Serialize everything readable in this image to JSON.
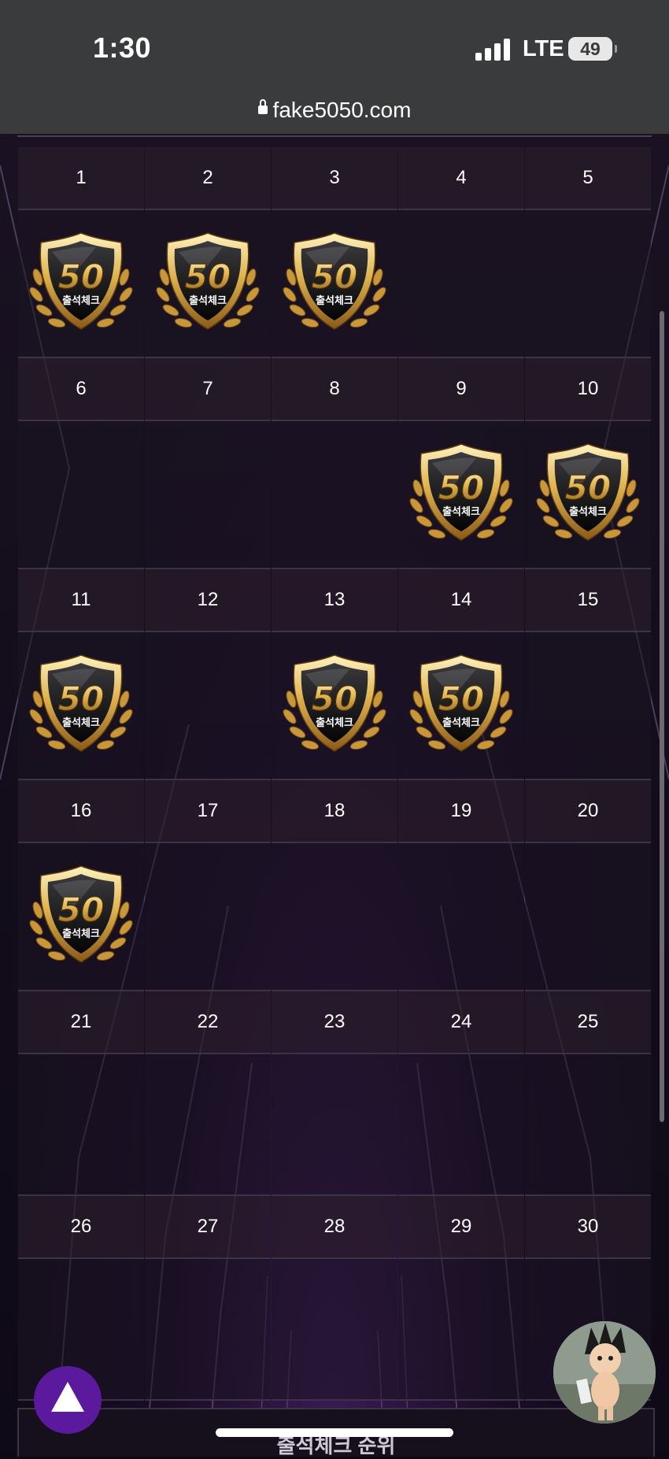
{
  "status_bar": {
    "time": "1:30",
    "network": "LTE",
    "battery": "49"
  },
  "browser": {
    "url": "fake5050.com"
  },
  "calendar": {
    "rows": [
      {
        "days": [
          {
            "day": "1",
            "stamped": true
          },
          {
            "day": "2",
            "stamped": true
          },
          {
            "day": "3",
            "stamped": true
          },
          {
            "day": "4",
            "stamped": false
          },
          {
            "day": "5",
            "stamped": false
          }
        ]
      },
      {
        "days": [
          {
            "day": "6",
            "stamped": false
          },
          {
            "day": "7",
            "stamped": false
          },
          {
            "day": "8",
            "stamped": false
          },
          {
            "day": "9",
            "stamped": true
          },
          {
            "day": "10",
            "stamped": true
          }
        ]
      },
      {
        "days": [
          {
            "day": "11",
            "stamped": true
          },
          {
            "day": "12",
            "stamped": false
          },
          {
            "day": "13",
            "stamped": true
          },
          {
            "day": "14",
            "stamped": true
          },
          {
            "day": "15",
            "stamped": false
          }
        ]
      },
      {
        "days": [
          {
            "day": "16",
            "stamped": true
          },
          {
            "day": "17",
            "stamped": false
          },
          {
            "day": "18",
            "stamped": false
          },
          {
            "day": "19",
            "stamped": false
          },
          {
            "day": "20",
            "stamped": false
          }
        ]
      },
      {
        "days": [
          {
            "day": "21",
            "stamped": false
          },
          {
            "day": "22",
            "stamped": false
          },
          {
            "day": "23",
            "stamped": false
          },
          {
            "day": "24",
            "stamped": false
          },
          {
            "day": "25",
            "stamped": false
          }
        ]
      },
      {
        "days": [
          {
            "day": "26",
            "stamped": false
          },
          {
            "day": "27",
            "stamped": false
          },
          {
            "day": "28",
            "stamped": false
          },
          {
            "day": "29",
            "stamped": false
          },
          {
            "day": "30",
            "stamped": false
          }
        ]
      }
    ],
    "badge": {
      "number": "50",
      "label": "출석체크"
    }
  },
  "bottom_panel": {
    "title": "출석체크 순위"
  },
  "icons": {
    "scroll_top": "up-triangle-icon",
    "avatar": "character-avatar-icon",
    "lock": "lock-icon"
  },
  "colors": {
    "accent": "#5b1a9e",
    "gold": "#d8a844",
    "background": "#120d19"
  }
}
